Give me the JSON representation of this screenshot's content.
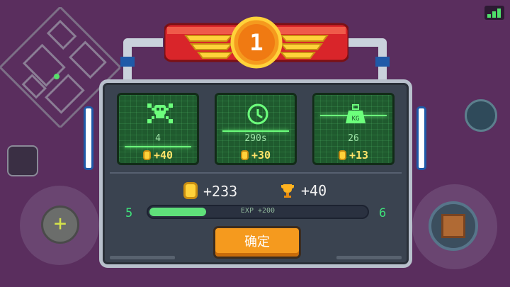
{
  "rank": {
    "value": "1"
  },
  "stats": [
    {
      "icon": "skull-icon",
      "value": "4",
      "bonus": "+40"
    },
    {
      "icon": "clock-icon",
      "value": "290s",
      "bonus": "+30"
    },
    {
      "icon": "weight-icon",
      "icon_label": "KG",
      "value": "26",
      "bonus": "+13"
    }
  ],
  "totals": {
    "coins": "+233",
    "trophies": "+40"
  },
  "experience": {
    "current_level": "5",
    "next_level": "6",
    "gain_text": "EXP +200",
    "progress_fraction": 0.27
  },
  "confirm_button": {
    "label": "确定"
  },
  "colors": {
    "accent_green": "#5fe07a",
    "gold": "#ffd23a",
    "button_orange": "#f59a1e",
    "banner_red": "#d9252a"
  }
}
